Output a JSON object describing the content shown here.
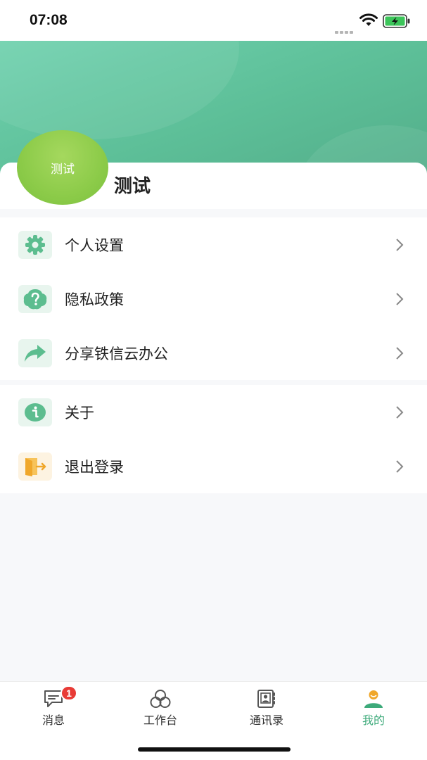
{
  "status_bar": {
    "time": "07:08"
  },
  "profile": {
    "avatar_text": "测试",
    "name": "测试"
  },
  "menu_groups": [
    [
      {
        "label": "个人设置",
        "icon": "gear-icon",
        "icon_color": "#5cbd8f"
      },
      {
        "label": "隐私政策",
        "icon": "question-icon",
        "icon_color": "#5cbd8f"
      },
      {
        "label": "分享铁信云办公",
        "icon": "share-icon",
        "icon_color": "#5cbd8f"
      }
    ],
    [
      {
        "label": "关于",
        "icon": "info-icon",
        "icon_color": "#5cbd8f"
      },
      {
        "label": "退出登录",
        "icon": "logout-icon",
        "icon_color": "#f5b02e"
      }
    ]
  ],
  "tab_bar": {
    "tabs": [
      {
        "label": "消息",
        "icon": "message-icon",
        "badge": "1"
      },
      {
        "label": "工作台",
        "icon": "workbench-icon"
      },
      {
        "label": "通讯录",
        "icon": "contacts-icon"
      },
      {
        "label": "我的",
        "icon": "profile-icon",
        "active": true
      }
    ]
  },
  "colors": {
    "accent": "#3daa7a",
    "header_gradient_start": "#6fd1ae",
    "header_gradient_end": "#53ae8a",
    "badge": "#e83b36"
  }
}
